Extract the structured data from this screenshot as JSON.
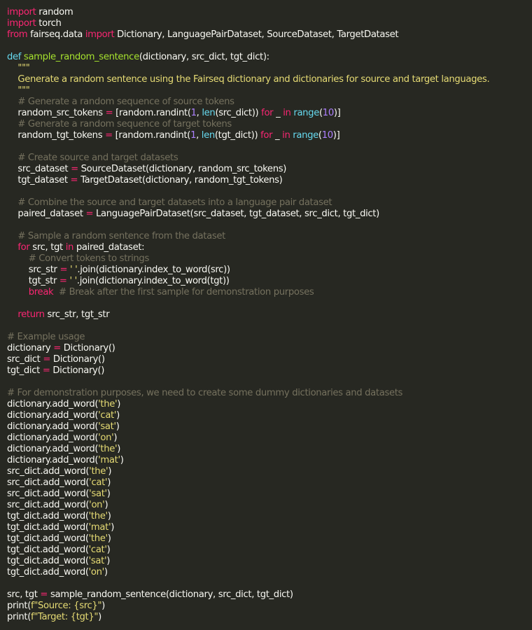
{
  "editor": {
    "colors": {
      "background": "#272822",
      "text": "#F8F8F2",
      "keyword": "#F92672",
      "def": "#66D9EF",
      "function": "#A6E22E",
      "string": "#E6DB74",
      "number": "#AE81FF",
      "comment": "#75715E"
    },
    "lines": [
      [
        [
          "kw",
          "import"
        ],
        [
          "text",
          " random"
        ]
      ],
      [
        [
          "kw",
          "import"
        ],
        [
          "text",
          " torch"
        ]
      ],
      [
        [
          "kw",
          "from"
        ],
        [
          "text",
          " fairseq.data "
        ],
        [
          "kw",
          "import"
        ],
        [
          "text",
          " Dictionary, LanguagePairDataset, SourceDataset, TargetDataset"
        ]
      ],
      [],
      [
        [
          "def",
          "def"
        ],
        [
          "text",
          " "
        ],
        [
          "fn",
          "sample_random_sentence"
        ],
        [
          "text",
          "(dictionary, src_dict, tgt_dict):"
        ]
      ],
      [
        [
          "str",
          "    \"\"\""
        ]
      ],
      [
        [
          "str",
          "    Generate a random sentence using the Fairseq dictionary and dictionaries for source and target languages."
        ]
      ],
      [
        [
          "str",
          "    \"\"\""
        ]
      ],
      [
        [
          "cmt",
          "    # Generate a random sequence of source tokens"
        ]
      ],
      [
        [
          "text",
          "    random_src_tokens "
        ],
        [
          "op",
          "="
        ],
        [
          "text",
          " [random.randint("
        ],
        [
          "num",
          "1"
        ],
        [
          "text",
          ", "
        ],
        [
          "bi",
          "len"
        ],
        [
          "text",
          "(src_dict)) "
        ],
        [
          "kw",
          "for"
        ],
        [
          "text",
          " _ "
        ],
        [
          "kw",
          "in"
        ],
        [
          "text",
          " "
        ],
        [
          "bi",
          "range"
        ],
        [
          "text",
          "("
        ],
        [
          "num",
          "10"
        ],
        [
          "text",
          ")]"
        ]
      ],
      [
        [
          "cmt",
          "    # Generate a random sequence of target tokens"
        ]
      ],
      [
        [
          "text",
          "    random_tgt_tokens "
        ],
        [
          "op",
          "="
        ],
        [
          "text",
          " [random.randint("
        ],
        [
          "num",
          "1"
        ],
        [
          "text",
          ", "
        ],
        [
          "bi",
          "len"
        ],
        [
          "text",
          "(tgt_dict)) "
        ],
        [
          "kw",
          "for"
        ],
        [
          "text",
          " _ "
        ],
        [
          "kw",
          "in"
        ],
        [
          "text",
          " "
        ],
        [
          "bi",
          "range"
        ],
        [
          "text",
          "("
        ],
        [
          "num",
          "10"
        ],
        [
          "text",
          ")]"
        ]
      ],
      [],
      [
        [
          "cmt",
          "    # Create source and target datasets"
        ]
      ],
      [
        [
          "text",
          "    src_dataset "
        ],
        [
          "op",
          "="
        ],
        [
          "text",
          " SourceDataset(dictionary, random_src_tokens)"
        ]
      ],
      [
        [
          "text",
          "    tgt_dataset "
        ],
        [
          "op",
          "="
        ],
        [
          "text",
          " TargetDataset(dictionary, random_tgt_tokens)"
        ]
      ],
      [],
      [
        [
          "cmt",
          "    # Combine the source and target datasets into a language pair dataset"
        ]
      ],
      [
        [
          "text",
          "    paired_dataset "
        ],
        [
          "op",
          "="
        ],
        [
          "text",
          " LanguagePairDataset(src_dataset, tgt_dataset, src_dict, tgt_dict)"
        ]
      ],
      [],
      [
        [
          "cmt",
          "    # Sample a random sentence from the dataset"
        ]
      ],
      [
        [
          "text",
          "    "
        ],
        [
          "kw",
          "for"
        ],
        [
          "text",
          " src, tgt "
        ],
        [
          "kw",
          "in"
        ],
        [
          "text",
          " paired_dataset:"
        ]
      ],
      [
        [
          "cmt",
          "        # Convert tokens to strings"
        ]
      ],
      [
        [
          "text",
          "        src_str "
        ],
        [
          "op",
          "="
        ],
        [
          "text",
          " "
        ],
        [
          "str",
          "' '"
        ],
        [
          "text",
          ".join(dictionary.index_to_word(src))"
        ]
      ],
      [
        [
          "text",
          "        tgt_str "
        ],
        [
          "op",
          "="
        ],
        [
          "text",
          " "
        ],
        [
          "str",
          "' '"
        ],
        [
          "text",
          ".join(dictionary.index_to_word(tgt))"
        ]
      ],
      [
        [
          "text",
          "        "
        ],
        [
          "kw",
          "break"
        ],
        [
          "text",
          "  "
        ],
        [
          "cmt",
          "# Break after the first sample for demonstration purposes"
        ]
      ],
      [],
      [
        [
          "text",
          "    "
        ],
        [
          "kw",
          "return"
        ],
        [
          "text",
          " src_str, tgt_str"
        ]
      ],
      [],
      [
        [
          "cmt",
          "# Example usage"
        ]
      ],
      [
        [
          "text",
          "dictionary "
        ],
        [
          "op",
          "="
        ],
        [
          "text",
          " Dictionary()"
        ]
      ],
      [
        [
          "text",
          "src_dict "
        ],
        [
          "op",
          "="
        ],
        [
          "text",
          " Dictionary()"
        ]
      ],
      [
        [
          "text",
          "tgt_dict "
        ],
        [
          "op",
          "="
        ],
        [
          "text",
          " Dictionary()"
        ]
      ],
      [],
      [
        [
          "cmt",
          "# For demonstration purposes, we need to create some dummy dictionaries and datasets"
        ]
      ],
      [
        [
          "text",
          "dictionary.add_word("
        ],
        [
          "str",
          "'the'"
        ],
        [
          "text",
          ")"
        ]
      ],
      [
        [
          "text",
          "dictionary.add_word("
        ],
        [
          "str",
          "'cat'"
        ],
        [
          "text",
          ")"
        ]
      ],
      [
        [
          "text",
          "dictionary.add_word("
        ],
        [
          "str",
          "'sat'"
        ],
        [
          "text",
          ")"
        ]
      ],
      [
        [
          "text",
          "dictionary.add_word("
        ],
        [
          "str",
          "'on'"
        ],
        [
          "text",
          ")"
        ]
      ],
      [
        [
          "text",
          "dictionary.add_word("
        ],
        [
          "str",
          "'the'"
        ],
        [
          "text",
          ")"
        ]
      ],
      [
        [
          "text",
          "dictionary.add_word("
        ],
        [
          "str",
          "'mat'"
        ],
        [
          "text",
          ")"
        ]
      ],
      [
        [
          "text",
          "src_dict.add_word("
        ],
        [
          "str",
          "'the'"
        ],
        [
          "text",
          ")"
        ]
      ],
      [
        [
          "text",
          "src_dict.add_word("
        ],
        [
          "str",
          "'cat'"
        ],
        [
          "text",
          ")"
        ]
      ],
      [
        [
          "text",
          "src_dict.add_word("
        ],
        [
          "str",
          "'sat'"
        ],
        [
          "text",
          ")"
        ]
      ],
      [
        [
          "text",
          "src_dict.add_word("
        ],
        [
          "str",
          "'on'"
        ],
        [
          "text",
          ")"
        ]
      ],
      [
        [
          "text",
          "tgt_dict.add_word("
        ],
        [
          "str",
          "'the'"
        ],
        [
          "text",
          ")"
        ]
      ],
      [
        [
          "text",
          "tgt_dict.add_word("
        ],
        [
          "str",
          "'mat'"
        ],
        [
          "text",
          ")"
        ]
      ],
      [
        [
          "text",
          "tgt_dict.add_word("
        ],
        [
          "str",
          "'the'"
        ],
        [
          "text",
          ")"
        ]
      ],
      [
        [
          "text",
          "tgt_dict.add_word("
        ],
        [
          "str",
          "'cat'"
        ],
        [
          "text",
          ")"
        ]
      ],
      [
        [
          "text",
          "tgt_dict.add_word("
        ],
        [
          "str",
          "'sat'"
        ],
        [
          "text",
          ")"
        ]
      ],
      [
        [
          "text",
          "tgt_dict.add_word("
        ],
        [
          "str",
          "'on'"
        ],
        [
          "text",
          ")"
        ]
      ],
      [],
      [
        [
          "text",
          "src, tgt "
        ],
        [
          "op",
          "="
        ],
        [
          "text",
          " sample_random_sentence(dictionary, src_dict, tgt_dict)"
        ]
      ],
      [
        [
          "text",
          "print("
        ],
        [
          "str",
          "f\"Source: {src}\""
        ],
        [
          "text",
          ")"
        ]
      ],
      [
        [
          "text",
          "print("
        ],
        [
          "str",
          "f\"Target: {tgt}\""
        ],
        [
          "text",
          ")"
        ]
      ]
    ]
  }
}
